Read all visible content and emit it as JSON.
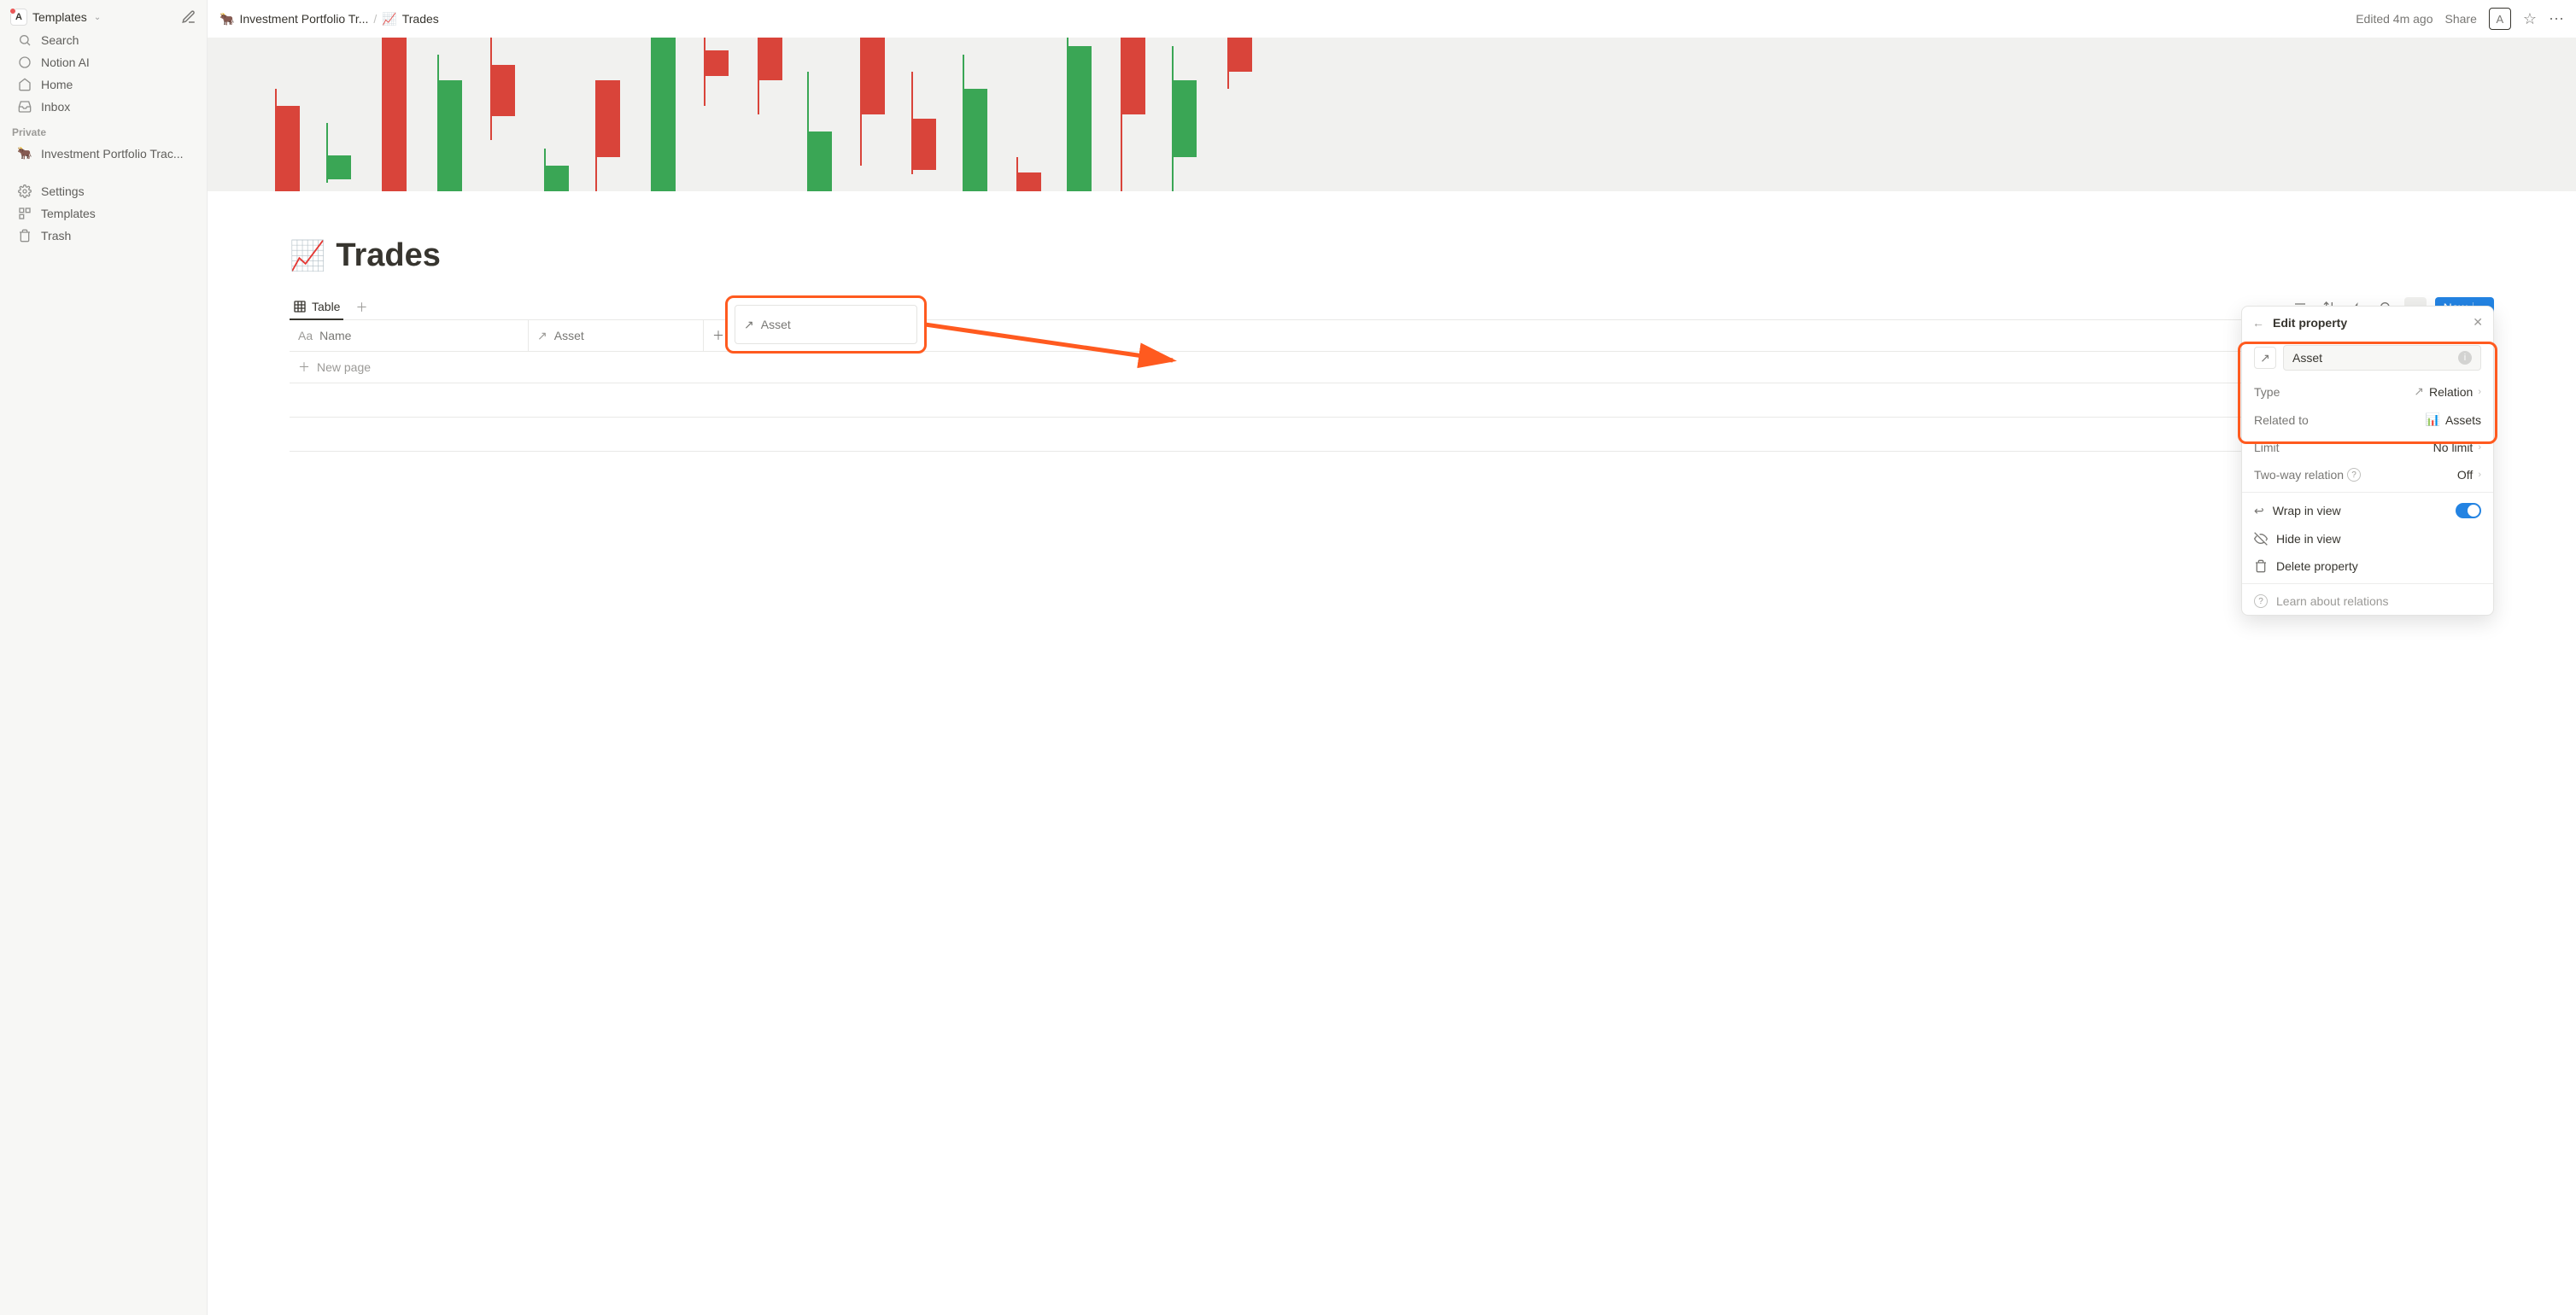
{
  "workspace": {
    "name": "Templates",
    "initial": "A"
  },
  "sidebar": {
    "search": "Search",
    "ai": "Notion AI",
    "home": "Home",
    "inbox": "Inbox",
    "section": "Private",
    "page": "Investment Portfolio Trac...",
    "settings": "Settings",
    "templates": "Templates",
    "trash": "Trash"
  },
  "breadcrumbs": {
    "first": "Investment Portfolio Tr...",
    "second": "Trades"
  },
  "topbar": {
    "edited": "Edited 4m ago",
    "share": "Share",
    "avatar": "A"
  },
  "page": {
    "icon": "📈",
    "title": "Trades"
  },
  "view": {
    "tab": "Table",
    "new": "New"
  },
  "columns": {
    "name": "Name",
    "asset": "Asset",
    "newpage": "New page"
  },
  "panel": {
    "title": "Edit property",
    "name_value": "Asset",
    "type_label": "Type",
    "type_value": "Relation",
    "related_label": "Related to",
    "related_value": "Assets",
    "limit_label": "Limit",
    "limit_value": "No limit",
    "twoway_label": "Two-way relation",
    "twoway_value": "Off",
    "wrap": "Wrap in view",
    "hide": "Hide in view",
    "delete": "Delete property",
    "learn": "Learn about relations"
  },
  "icons": {
    "relation": "↗",
    "chart": "📊",
    "plus": "＋",
    "more": "⋯",
    "search": "🔍",
    "filter": "≡",
    "sort": "↕",
    "bolt": "⚡",
    "star": "☆",
    "menu": "⋯"
  }
}
